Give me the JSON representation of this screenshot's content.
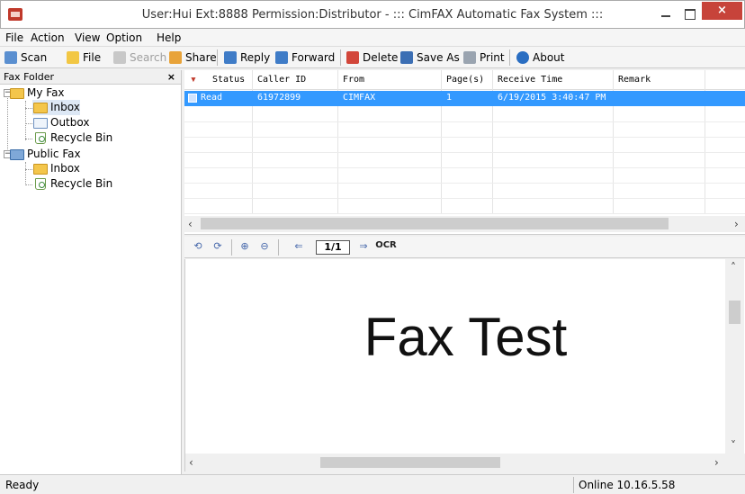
{
  "window": {
    "title": "User:Hui  Ext:8888  Permission:Distributor - ::: CimFAX Automatic Fax System :::",
    "close_glyph": "×"
  },
  "menu": [
    "File",
    "Action",
    "View",
    "Option",
    "Help"
  ],
  "toolbar": {
    "scan": "Scan",
    "file": "File",
    "search": "Search",
    "share": "Share",
    "reply": "Reply",
    "forward": "Forward",
    "delete": "Delete",
    "save_as": "Save As",
    "print": "Print",
    "about": "About"
  },
  "folder_panel": {
    "title": "Fax Folder",
    "close": "×",
    "tree": {
      "my_fax": "My Fax",
      "inbox": "Inbox",
      "outbox": "Outbox",
      "recycle_bin": "Recycle Bin",
      "public_fax": "Public Fax",
      "public_inbox": "Inbox",
      "public_recycle_bin": "Recycle Bin"
    }
  },
  "fax_list": {
    "columns": {
      "status": "Status",
      "caller_id": "Caller ID",
      "from": "From",
      "pages": "Page(s)",
      "receive_time": "Receive Time",
      "remark": "Remark"
    },
    "rows": [
      {
        "status": "Read",
        "caller_id": "61972899",
        "from": "CIMFAX",
        "pages": "1",
        "receive_time": "6/19/2015 3:40:47 PM",
        "remark": ""
      }
    ]
  },
  "viewer_toolbar": {
    "page": "1/1",
    "ocr": "OCR"
  },
  "viewer": {
    "content": "Fax Test"
  },
  "status_bar": {
    "left": "Ready",
    "right": "Online 10.16.5.58"
  },
  "colors": {
    "selection": "#3399ff",
    "close_button": "#c7433a"
  }
}
